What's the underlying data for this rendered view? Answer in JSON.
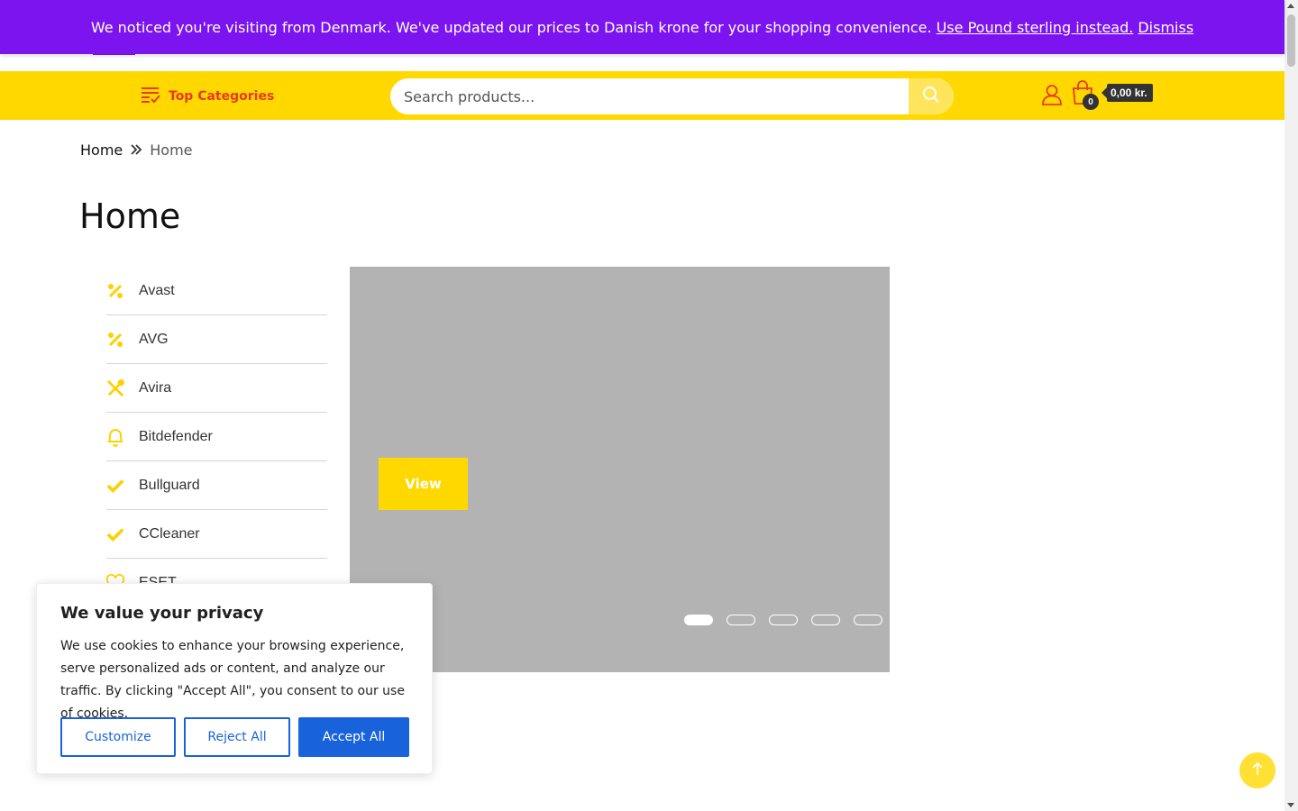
{
  "notice": {
    "message": "We noticed you're visiting from Denmark. We've updated our prices to Danish krone for your shopping convenience.",
    "switch_link": "Use Pound sterling instead.",
    "dismiss_link": "Dismiss"
  },
  "header": {
    "top_categories_label": "Top Categories",
    "search_placeholder": "Search products...",
    "cart_count": "0",
    "cart_total": "0,00 kr."
  },
  "breadcrumb": {
    "home": "Home",
    "current": "Home"
  },
  "page_title": "Home",
  "categories": [
    {
      "label": "Avast",
      "icon": "percent-icon"
    },
    {
      "label": "AVG",
      "icon": "percent-icon"
    },
    {
      "label": "Avira",
      "icon": "tools-icon"
    },
    {
      "label": "Bitdefender",
      "icon": "bell-icon"
    },
    {
      "label": "Bullguard",
      "icon": "check-icon"
    },
    {
      "label": "CCleaner",
      "icon": "check-icon"
    },
    {
      "label": "ESET",
      "icon": "heart-icon"
    }
  ],
  "slider": {
    "button_label": "View",
    "active_slide": 1,
    "slide_count": 5
  },
  "cookie": {
    "title": "We value your privacy",
    "text": "We use cookies to enhance your browsing experience, serve personalized ads or content, and analyze our traffic. By clicking \"Accept All\", you consent to our use of cookies.",
    "customize_label": "Customize",
    "reject_label": "Reject All",
    "accept_label": "Accept All"
  },
  "colors": {
    "notice_bg": "#7b14ef",
    "header_bar": "#ffd800",
    "accent_red": "#e83a1d",
    "cookie_blue": "#1863dc"
  }
}
